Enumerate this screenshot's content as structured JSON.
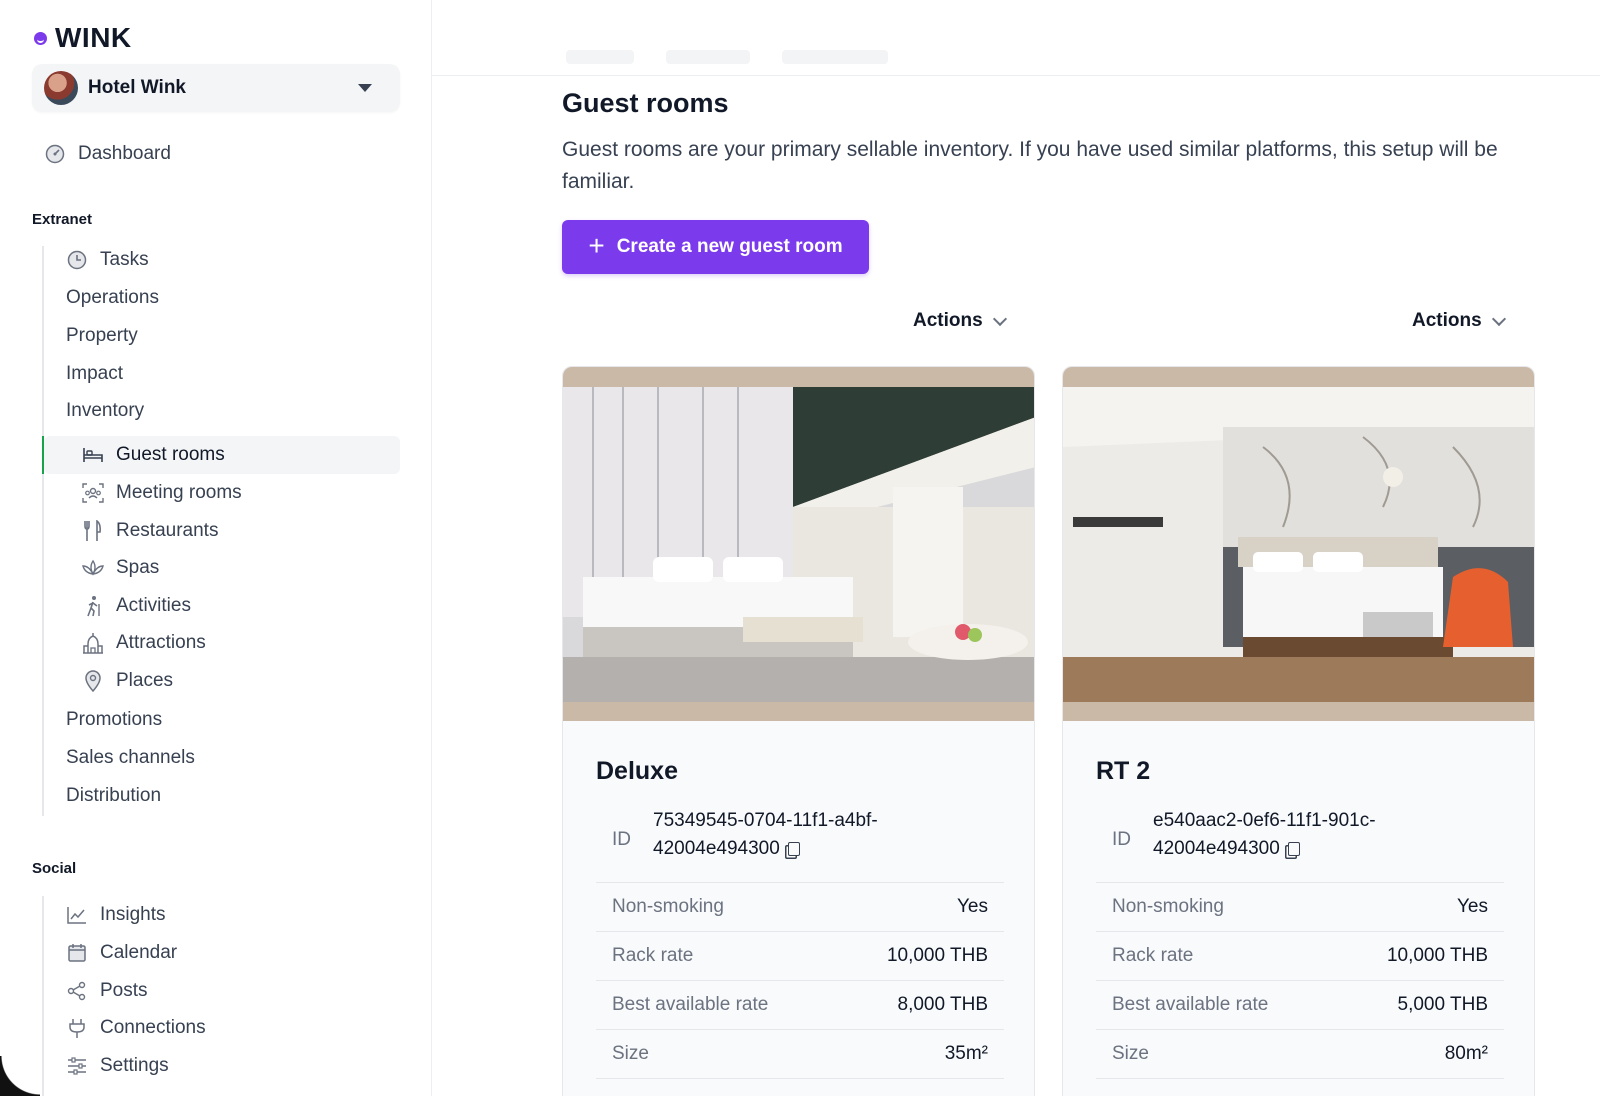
{
  "brand": {
    "name": "WINK"
  },
  "hotel": {
    "name": "Hotel Wink"
  },
  "sidebar": {
    "dashboard": "Dashboard",
    "extranet_title": "Extranet",
    "extranet": {
      "tasks": "Tasks",
      "operations": "Operations",
      "property": "Property",
      "impact": "Impact",
      "inventory": "Inventory",
      "inventory_items": {
        "guest_rooms": "Guest rooms",
        "meeting_rooms": "Meeting rooms",
        "restaurants": "Restaurants",
        "spas": "Spas",
        "activities": "Activities",
        "attractions": "Attractions",
        "places": "Places"
      },
      "promotions": "Promotions",
      "sales_channels": "Sales channels",
      "distribution": "Distribution"
    },
    "social_title": "Social",
    "social": {
      "insights": "Insights",
      "calendar": "Calendar",
      "posts": "Posts",
      "connections": "Connections",
      "settings": "Settings"
    }
  },
  "main": {
    "title": "Guest rooms",
    "description": "Guest rooms are your primary sellable inventory. If you have used similar platforms, this setup will be familiar.",
    "create_button": "Create a new guest room",
    "actions_label": "Actions"
  },
  "rooms": [
    {
      "name": "Deluxe",
      "id_label": "ID",
      "id_value": "75349545-0704-11f1-a4bf-42004e494300",
      "attributes": [
        {
          "label": "Non-smoking",
          "value": "Yes"
        },
        {
          "label": "Rack rate",
          "value": "10,000 THB"
        },
        {
          "label": "Best available rate",
          "value": "8,000 THB"
        },
        {
          "label": "Size",
          "value": "35m²"
        }
      ]
    },
    {
      "name": "RT 2",
      "id_label": "ID",
      "id_value": "e540aac2-0ef6-11f1-901c-42004e494300",
      "attributes": [
        {
          "label": "Non-smoking",
          "value": "Yes"
        },
        {
          "label": "Rack rate",
          "value": "10,000 THB"
        },
        {
          "label": "Best available rate",
          "value": "5,000 THB"
        },
        {
          "label": "Size",
          "value": "80m²"
        }
      ]
    }
  ],
  "colors": {
    "accent": "#7c3aed",
    "active_marker": "#16a34a"
  }
}
